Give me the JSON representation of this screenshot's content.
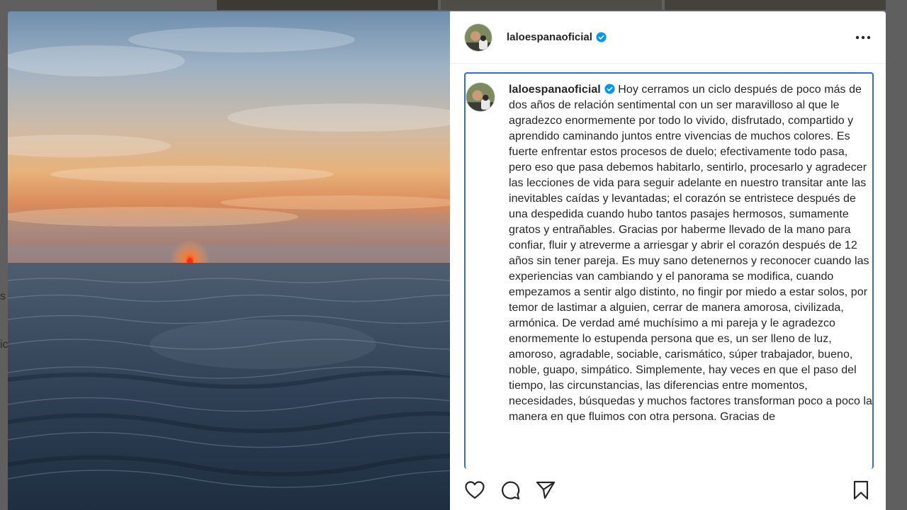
{
  "background": {
    "left_fragment_1": "s",
    "left_fragment_2": "ic"
  },
  "post": {
    "username": "laloespanaoficial",
    "verified": true,
    "icons": {
      "more": "more-horizontal-icon",
      "like": "heart-icon",
      "comment": "comment-icon",
      "share": "paper-plane-icon",
      "save": "bookmark-icon"
    },
    "caption": {
      "username": "laloespanaoficial",
      "text": "Hoy cerramos un ciclo después de poco más de dos años de relación sentimental con un ser maravilloso al que le agradezco enormemente por todo lo vivido, disfrutado, compartido y aprendido caminando juntos entre vivencias de muchos colores. Es fuerte enfrentar estos procesos de duelo; efectivamente todo pasa, pero eso que pasa debemos habitarlo, sentirlo, procesarlo y agradecer las lecciones de vida para seguir adelante en nuestro transitar ante las inevitables caídas y levantadas; el corazón se entristece después de una despedida cuando hubo tantos pasajes hermosos, sumamente gratos y entrañables. Gracias por haberme llevado de la mano para confiar, fluir y atreverme a arriesgar y abrir el corazón después de 12 años sin tener pareja. Es muy sano detenernos y reconocer cuando las experiencias van cambiando y el panorama se modifica, cuando empezamos a sentir algo distinto, no fingir por miedo a estar solos, por temor de lastimar a alguien, cerrar de manera amorosa, civilizada, armónica. De verdad amé muchísimo a mi pareja y le agradezco enormemente lo estupenda persona que es, un ser lleno de luz, amoroso, agradable, sociable, carismático, súper trabajador, bueno, noble, guapo, simpático. Simplemente, hay veces en que el paso del tiempo, las circunstancias, las diferencias entre momentos, necesidades, búsquedas y muchos factores transforman poco a poco la manera en que fluimos con otra persona. Gracias de"
    },
    "colors": {
      "accent_verified": "#0095f6",
      "focus_outline": "#2f6fd8",
      "text": "#262626"
    }
  }
}
